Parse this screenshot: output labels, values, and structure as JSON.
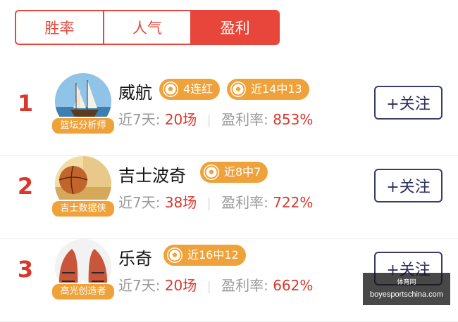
{
  "tabs": [
    {
      "label": "胜率",
      "active": false
    },
    {
      "label": "人气",
      "active": false
    },
    {
      "label": "盈利",
      "active": true
    }
  ],
  "experts": [
    {
      "rank": "1",
      "name": "威航",
      "badge": "篮坛分析师",
      "tags": [
        "4连红",
        "近14中13"
      ],
      "period_label": "近7天:",
      "matches": "20场",
      "rate_label": "盈利率:",
      "rate": "853%",
      "follow": "+关注"
    },
    {
      "rank": "2",
      "name": "吉士波奇",
      "badge": "吉士数据侠",
      "tags": [
        "近8中7"
      ],
      "period_label": "近7天:",
      "matches": "38场",
      "rate_label": "盈利率:",
      "rate": "722%",
      "follow": "+关注"
    },
    {
      "rank": "3",
      "name": "乐奇",
      "badge": "高光创造者",
      "tags": [
        "近16中12"
      ],
      "period_label": "近7天:",
      "matches": "20场",
      "rate_label": "盈利率:",
      "rate": "662%",
      "follow": "+关注"
    }
  ],
  "watermark": {
    "top": "体育网",
    "url": "boyesportschina.com"
  },
  "colors": {
    "accent": "#e8463a",
    "tag": "#efa23a",
    "number": "#d9362c",
    "follow_border": "#3b3b6b"
  }
}
